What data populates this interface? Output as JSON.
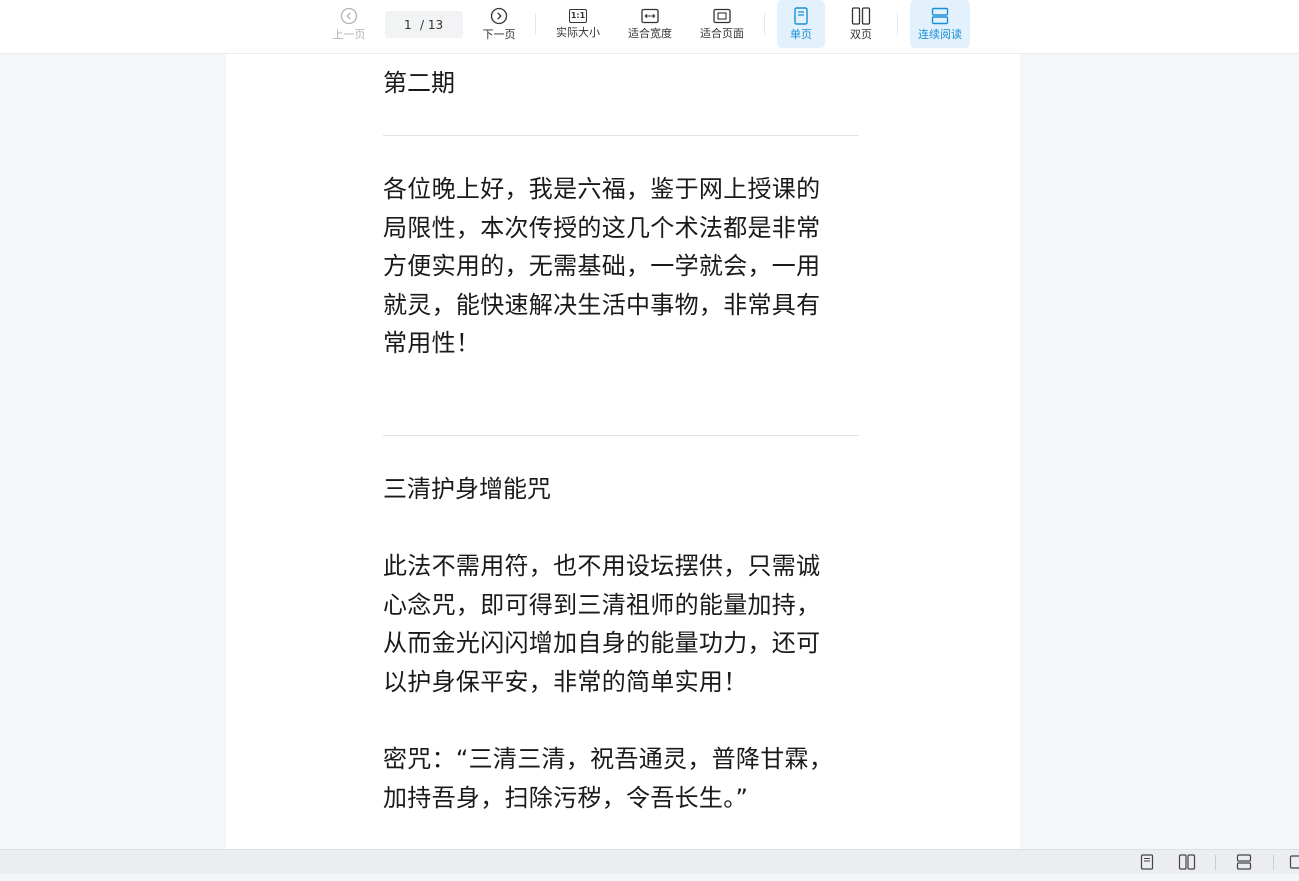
{
  "toolbar": {
    "prev_label": "上一页",
    "next_label": "下一页",
    "current_page": "1",
    "total_pages": "/ 13",
    "actual_size_label": "实际大小",
    "actual_size_icon_text": "1:1",
    "fit_width_label": "适合宽度",
    "fit_page_label": "适合页面",
    "single_page_label": "单页",
    "double_page_label": "双页",
    "continuous_label": "连续阅读",
    "accent_color": "#1890d5",
    "active_bg_color": "#e3f1fc"
  },
  "document": {
    "section_title": "第二期",
    "intro": "各位晚上好，我是六福，鉴于网上授课的\n局限性，本次传授的这几个术法都是非常\n方便实用的，无需基础，一学就会，一用\n就灵，能快速解决生活中事物，非常具有\n常用性！",
    "spell_title": "三清护身增能咒",
    "spell_desc": "此法不需用符，也不用设坛摆供，只需诚\n心念咒，即可得到三清祖师的能量加持，\n从而金光闪闪增加自身的能量功力，还可\n以护身保平安，非常的简单实用！",
    "mantra": "密咒：“三清三清，祝吾通灵，普降甘霖，\n加持吾身，扫除污秽，令吾长生。”"
  },
  "statusbar": {
    "icons": [
      "single-page-icon",
      "double-page-icon",
      "continuous-icon",
      "fullscreen-icon"
    ]
  }
}
